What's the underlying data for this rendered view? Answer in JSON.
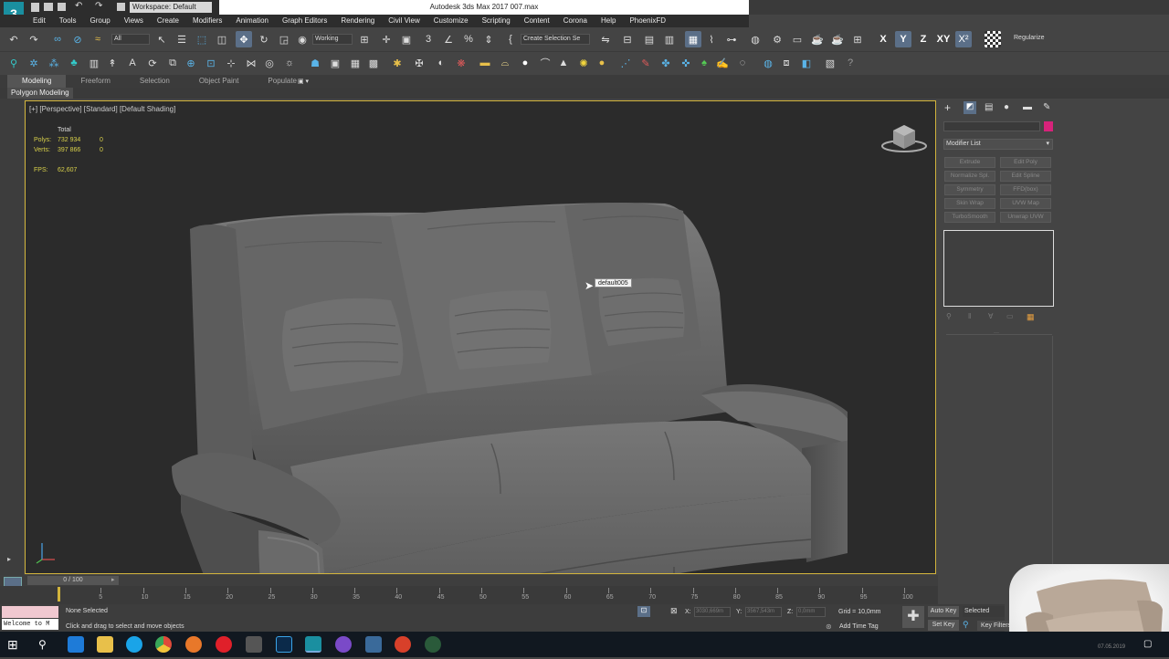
{
  "window": {
    "title": "Autodesk 3ds Max 2017    007.max",
    "workspace": "Workspace: Default"
  },
  "menu": [
    "Edit",
    "Tools",
    "Group",
    "Views",
    "Create",
    "Modifiers",
    "Animation",
    "Graph Editors",
    "Rendering",
    "Civil View",
    "Customize",
    "Scripting",
    "Content",
    "Corona",
    "Help",
    "PhoenixFD"
  ],
  "toolbar": {
    "filter": "All",
    "coord": "Working",
    "selection_set": "Create Selection Se",
    "axis_x": "X",
    "axis_y": "Y",
    "axis_z": "Z",
    "axis_xy": "XY",
    "regularize": "Regularize"
  },
  "ribbon": {
    "tabs": [
      "Modeling",
      "Freeform",
      "Selection",
      "Object Paint",
      "Populate"
    ],
    "active": "Modeling",
    "panel": "Polygon Modeling"
  },
  "viewport": {
    "label": "[+] [Perspective] [Standard] [Default Shading]",
    "stats_header": "Total",
    "polys_label": "Polys:",
    "polys_total": "732 934",
    "polys_sel": "0",
    "verts_label": "Verts:",
    "verts_total": "397 866",
    "verts_sel": "0",
    "fps_label": "FPS:",
    "fps": "62,607",
    "tooltip": "default005"
  },
  "command_panel": {
    "modifier_list": "Modifier List",
    "buttons": [
      [
        "Extrude",
        "Edit Poly"
      ],
      [
        "Normalize Spl.",
        "Edit Spline"
      ],
      [
        "Symmetry",
        "FFD(box)"
      ],
      [
        "Skin Wrap",
        "UVW Map"
      ],
      [
        "TurboSmooth",
        "Unwrap UVW"
      ]
    ]
  },
  "timeline": {
    "position": "0 / 100",
    "ticks": [
      "0",
      "5",
      "10",
      "15",
      "20",
      "25",
      "30",
      "35",
      "40",
      "45",
      "50",
      "55",
      "60",
      "65",
      "70",
      "75",
      "80",
      "85",
      "90",
      "95",
      "100"
    ]
  },
  "status": {
    "maxscript": "Welcome to M",
    "selection": "None Selected",
    "prompt": "Click and drag to select and move objects",
    "x_label": "X:",
    "x": "3030,669m",
    "y_label": "Y:",
    "y": "3567,543m",
    "z_label": "Z:",
    "z": "0,0mm",
    "grid": "Grid = 10,0mm",
    "add_time_tag": "Add Time Tag",
    "auto_key": "Auto Key",
    "selected": "Selected",
    "set_key": "Set Key",
    "key_filters": "Key Filters..."
  },
  "taskbar": {
    "date": "07.05.2019"
  },
  "colors": {
    "viewport_border": "#d2b43c",
    "stats": "#d8d04a",
    "object_color": "#d6237a"
  }
}
